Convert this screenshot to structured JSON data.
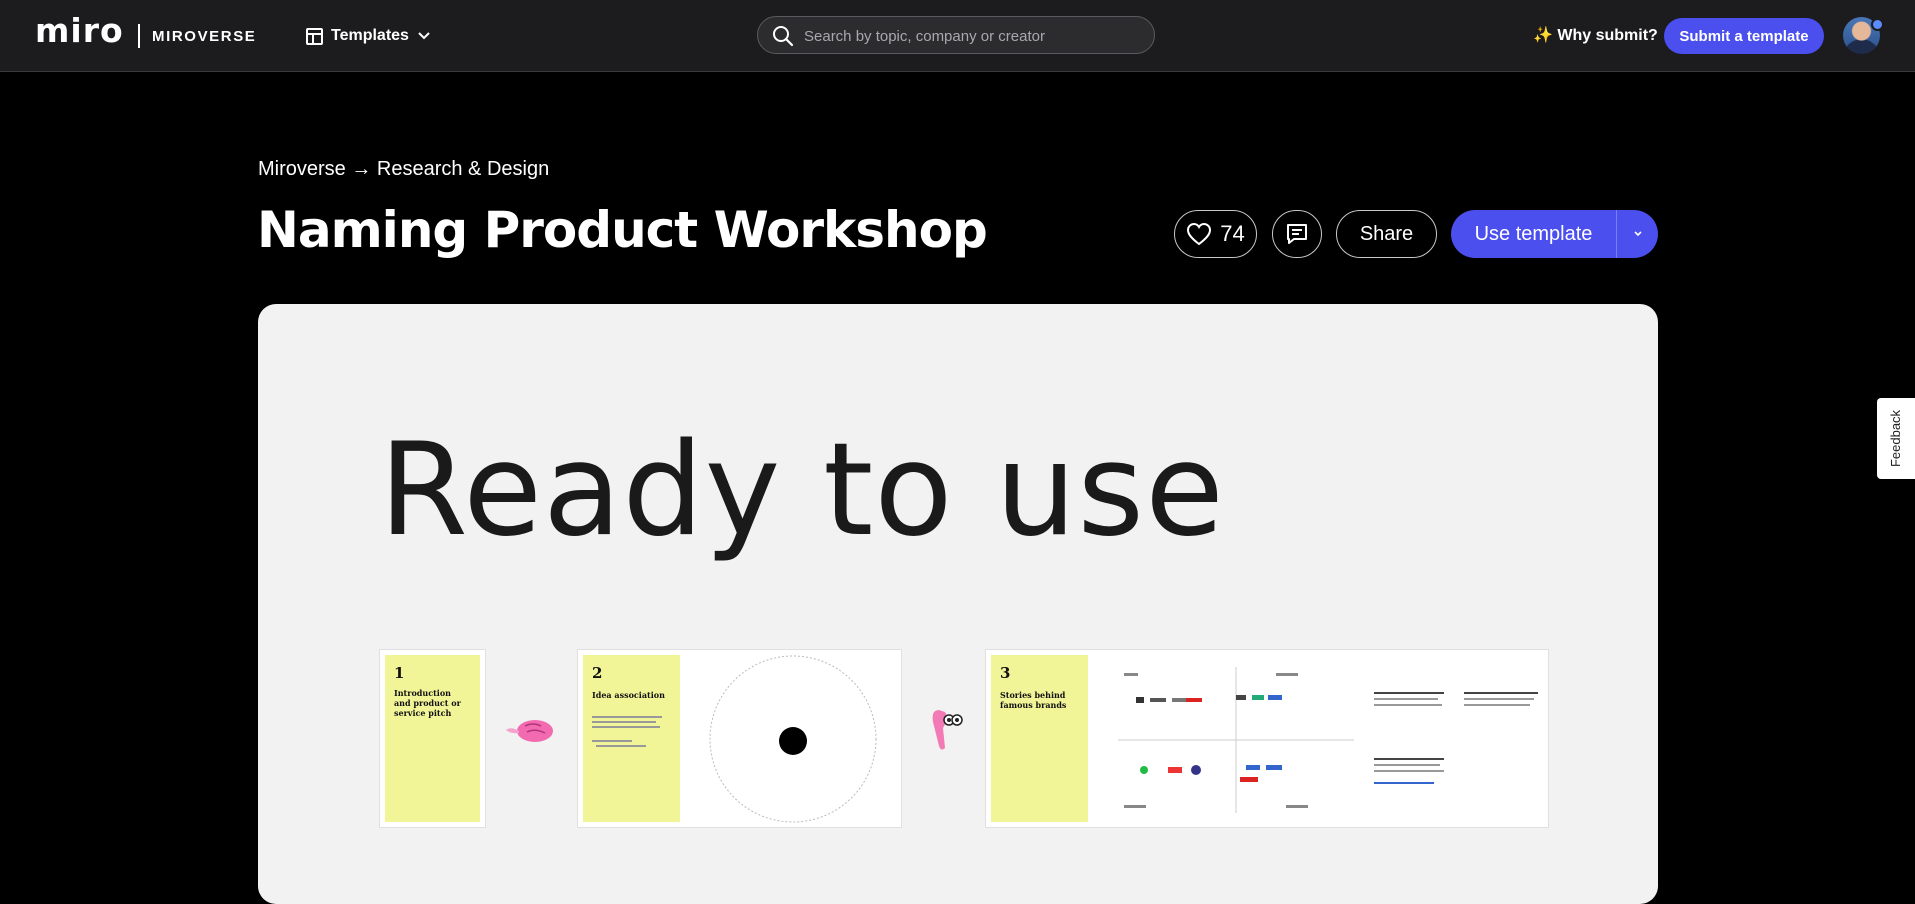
{
  "nav": {
    "logo": "miro",
    "product": "MIROVERSE",
    "templates_label": "Templates",
    "search_placeholder": "Search by topic, company or creator",
    "why_submit": "✨ Why submit?",
    "submit_label": "Submit a template"
  },
  "header": {
    "breadcrumb": "Miroverse → Research & Design",
    "title": "Naming Product Workshop",
    "likes": "74",
    "share_label": "Share",
    "use_template_label": "Use template"
  },
  "preview": {
    "headline": "Ready to use",
    "frames": [
      {
        "number": "1",
        "title": "Introduction and product or service pitch"
      },
      {
        "number": "2",
        "title": "Idea association"
      },
      {
        "number": "3",
        "title": "Stories behind famous brands"
      }
    ]
  },
  "feedback_label": "Feedback",
  "colors": {
    "accent": "#4a4fee",
    "topbar": "#1c1c1e",
    "frame_yellow": "#f2f597"
  }
}
